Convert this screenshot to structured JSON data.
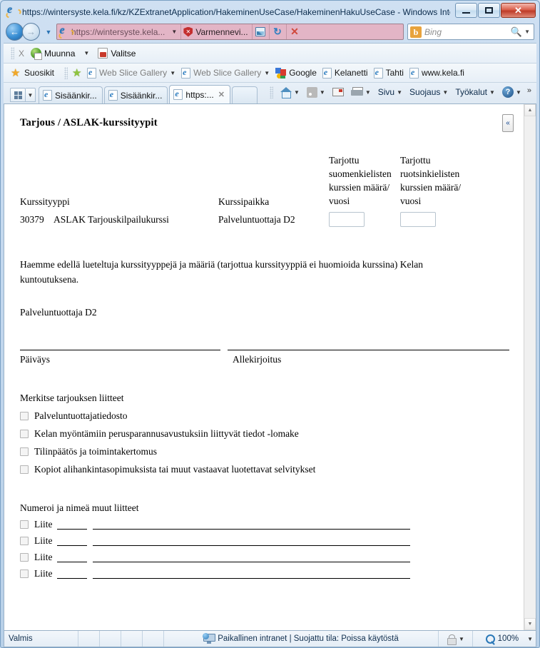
{
  "window": {
    "title": "https://wintersyste.kela.fi/kz/KZExtranetApplication/HakeminenUseCase/HakeminenHakuUseCase - Windows Inter...",
    "minimize_label": "Pienennä",
    "maximize_label": "Suurenna",
    "close_label": "Sulje"
  },
  "navigation": {
    "back_label": "Takaisin",
    "forward_label": "Eteenpäin",
    "recent_pages_label": "Viimeisimmät sivut",
    "address": {
      "url": "https://wintersyste.kela...",
      "cert_warning": "Varmennevi...",
      "compat_label": "Yhteensopivuusnäkymä",
      "refresh_label": "Päivitä",
      "stop_label": "Pysäytä"
    },
    "search": {
      "provider": "Bing",
      "placeholder": "Bing",
      "value": ""
    }
  },
  "convert_toolbar": {
    "close_label": "X",
    "items": [
      {
        "label": "Muunna",
        "icon": "pdf-convert-icon",
        "has_caret": true
      },
      {
        "label": "Valitse",
        "icon": "pdf-select-icon",
        "has_caret": false
      }
    ]
  },
  "favorites_bar": {
    "favorites_label": "Suosikit",
    "items": [
      {
        "label": "Web Slice Gallery",
        "icon": "page-icon",
        "has_caret": true,
        "dim": true
      },
      {
        "label": "Web Slice Gallery",
        "icon": "page-icon",
        "has_caret": true,
        "dim": true
      },
      {
        "label": "Google",
        "icon": "google-icon",
        "has_caret": false,
        "dim": false
      },
      {
        "label": "Kelanetti",
        "icon": "page-icon",
        "has_caret": false,
        "dim": false
      },
      {
        "label": "Tahti",
        "icon": "page-icon",
        "has_caret": false,
        "dim": false
      },
      {
        "label": "www.kela.fi",
        "icon": "page-icon",
        "has_caret": false,
        "dim": false
      }
    ]
  },
  "tabs": {
    "quick_tabs_label": "Pikavälilehdet",
    "tab_list_label": "Välilehtiluettelo",
    "items": [
      {
        "label": "Sisäänkir...",
        "active": false
      },
      {
        "label": "Sisäänkir...",
        "active": false
      },
      {
        "label": "https:...",
        "active": true
      }
    ],
    "new_tab_label": "Uusi välilehti",
    "commands": [
      {
        "label": "Koti",
        "icon": "home-icon",
        "has_caret": true
      },
      {
        "label": "Syötteet",
        "icon": "feed-icon",
        "has_caret": true
      },
      {
        "label": "Lue sähköposti",
        "icon": "mail-icon",
        "has_caret": false
      },
      {
        "label": "Tulosta",
        "icon": "print-icon",
        "has_caret": true
      },
      {
        "label": "Sivu",
        "icon": "",
        "has_caret": true
      },
      {
        "label": "Suojaus",
        "icon": "",
        "has_caret": true
      },
      {
        "label": "Työkalut",
        "icon": "",
        "has_caret": true
      },
      {
        "label": "",
        "icon": "help-icon",
        "has_caret": true
      }
    ],
    "overflow_label": "»"
  },
  "page": {
    "doc_title": "Tarjous / ASLAK-kurssityypit",
    "collapse_button": "«",
    "table": {
      "header_type": "Kurssityyppi",
      "header_place": "Kurssipaikka",
      "header_fi_line1": "Tarjottu",
      "header_fi_line2": "suomenkielisten",
      "header_fi_line3": "kurssien määrä/",
      "header_fi_line4": "vuosi",
      "header_sv_line1": "Tarjottu",
      "header_sv_line2": "ruotsinkielisten",
      "header_sv_line3": "kurssien määrä/",
      "header_sv_line4": "vuosi",
      "rows": [
        {
          "code": "30379",
          "name": "ASLAK Tarjouskilpailukurssi",
          "place": "Palveluntuottaja D2",
          "count_fi": "",
          "count_sv": ""
        }
      ]
    },
    "paragraph": "Haemme edellä lueteltuja kurssityyppejä ja määriä (tarjottua kurssityyppiä ei huomioida kurssina) Kelan kuntoutuksena.",
    "provider": "Palveluntuottaja D2",
    "signature": {
      "date_label": "Päiväys",
      "signature_label": "Allekirjoitus"
    },
    "attachments": {
      "title": "Merkitse tarjouksen liitteet",
      "items": [
        {
          "label": "Palveluntuottajatiedosto",
          "checked": false
        },
        {
          "label": "Kelan myöntämiin perusparannusavustuksiin liittyvät tiedot -lomake",
          "checked": false
        },
        {
          "label": "Tilinpäätös ja toimintakertomus",
          "checked": false
        },
        {
          "label": "Kopiot alihankintasopimuksista tai muut vastaavat luotettavat selvitykset",
          "checked": false
        }
      ]
    },
    "other_attachments": {
      "title": "Numeroi ja nimeä muut liitteet",
      "items": [
        {
          "label": "Liite",
          "number": "",
          "name": "",
          "checked": false
        },
        {
          "label": "Liite",
          "number": "",
          "name": "",
          "checked": false
        },
        {
          "label": "Liite",
          "number": "",
          "name": "",
          "checked": false
        },
        {
          "label": "Liite",
          "number": "",
          "name": "",
          "checked": false
        }
      ]
    }
  },
  "statusbar": {
    "status": "Valmis",
    "zone": "Paikallinen intranet | Suojattu tila: Poissa käytöstä",
    "zoom": "100%"
  }
}
